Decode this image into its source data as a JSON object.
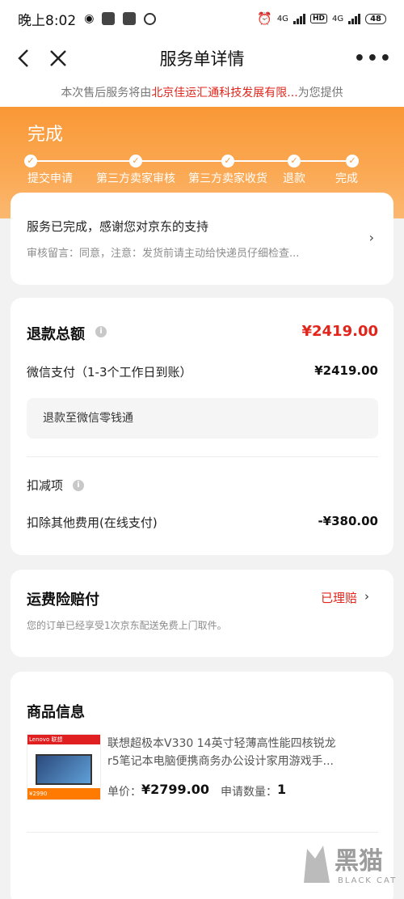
{
  "status_bar": {
    "time": "晚上8:02",
    "network_1": "4G",
    "hd": "HD",
    "network_2": "4G",
    "battery": "48"
  },
  "nav": {
    "title": "服务单详情",
    "more": "•••"
  },
  "notice": {
    "prefix": "本次售后服务将由",
    "company": "北京佳运汇通科技发展有限...",
    "suffix": "为您提供"
  },
  "progress": {
    "status": "完成",
    "steps": [
      "提交申请",
      "第三方卖家审核",
      "第三方卖家收货",
      "退款",
      "完成"
    ],
    "check": "✓"
  },
  "service_card": {
    "message": "服务已完成，感谢您对京东的支持",
    "review_note": "审核留言：同意，注意：发货前请主动给快递员仔细检查..."
  },
  "refund": {
    "title": "退款总额",
    "total": "¥2419.00",
    "payment_method": "微信支付（1-3个工作日到账）",
    "payment_amount": "¥2419.00",
    "destination": "退款至微信零钱通",
    "deduction_title": "扣减项",
    "deduction_label": "扣除其他费用(在线支付)",
    "deduction_amount": "-¥380.00"
  },
  "shipping_insurance": {
    "title": "运费险赔付",
    "status": "已理赔",
    "description": "您的订单已经享受1次京东配送免费上门取件。"
  },
  "product": {
    "section_title": "商品信息",
    "name": "联想超极本V330 14英寸轻薄高性能四核锐龙r5笔记本电脑便携商务办公设计家用游戏手...",
    "price_label": "单价：",
    "price": "¥2799.00",
    "qty_label": "申请数量：",
    "qty": "1",
    "image_bar_text": "Lenovo 联想",
    "image_tag_text": "¥2990"
  },
  "watermark": {
    "cn": "黑猫",
    "en": "BLACK CAT"
  },
  "colors": {
    "accent_red": "#e1251b",
    "hero_orange": "#f99836"
  }
}
